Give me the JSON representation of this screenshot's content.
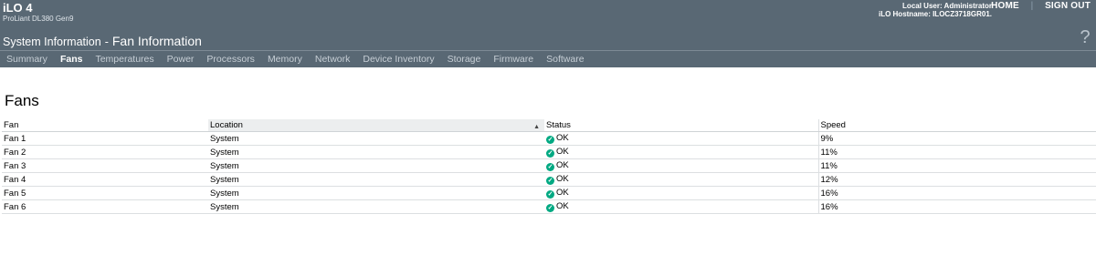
{
  "header": {
    "product": "iLO 4",
    "model": "ProLiant DL380 Gen9",
    "local_user": "Local User: Administrator",
    "hostname": "iLO Hostname: ILOCZ3718GR01.",
    "home_label": "HOME",
    "separator": "|",
    "signout_label": "SIGN OUT",
    "title_main": "System Information",
    "title_sep": "-",
    "title_sub": "Fan Information",
    "help_glyph": "?"
  },
  "tabs": [
    "Summary",
    "Fans",
    "Temperatures",
    "Power",
    "Processors",
    "Memory",
    "Network",
    "Device Inventory",
    "Storage",
    "Firmware",
    "Software"
  ],
  "active_tab": "Fans",
  "section_title": "Fans",
  "table": {
    "columns": [
      "Fan",
      "Location",
      "Status",
      "Speed"
    ],
    "sorted_column": "Location",
    "rows": [
      {
        "fan": "Fan 1",
        "location": "System",
        "status": "OK",
        "speed": "9%"
      },
      {
        "fan": "Fan 2",
        "location": "System",
        "status": "OK",
        "speed": "11%"
      },
      {
        "fan": "Fan 3",
        "location": "System",
        "status": "OK",
        "speed": "11%"
      },
      {
        "fan": "Fan 4",
        "location": "System",
        "status": "OK",
        "speed": "12%"
      },
      {
        "fan": "Fan 5",
        "location": "System",
        "status": "OK",
        "speed": "16%"
      },
      {
        "fan": "Fan 6",
        "location": "System",
        "status": "OK",
        "speed": "16%"
      }
    ]
  },
  "colors": {
    "header_bg": "#596874",
    "status_ok": "#01a982"
  },
  "icons": {
    "status": "check-circle-icon",
    "sort": "sort-ascending-icon",
    "help": "help-icon"
  }
}
